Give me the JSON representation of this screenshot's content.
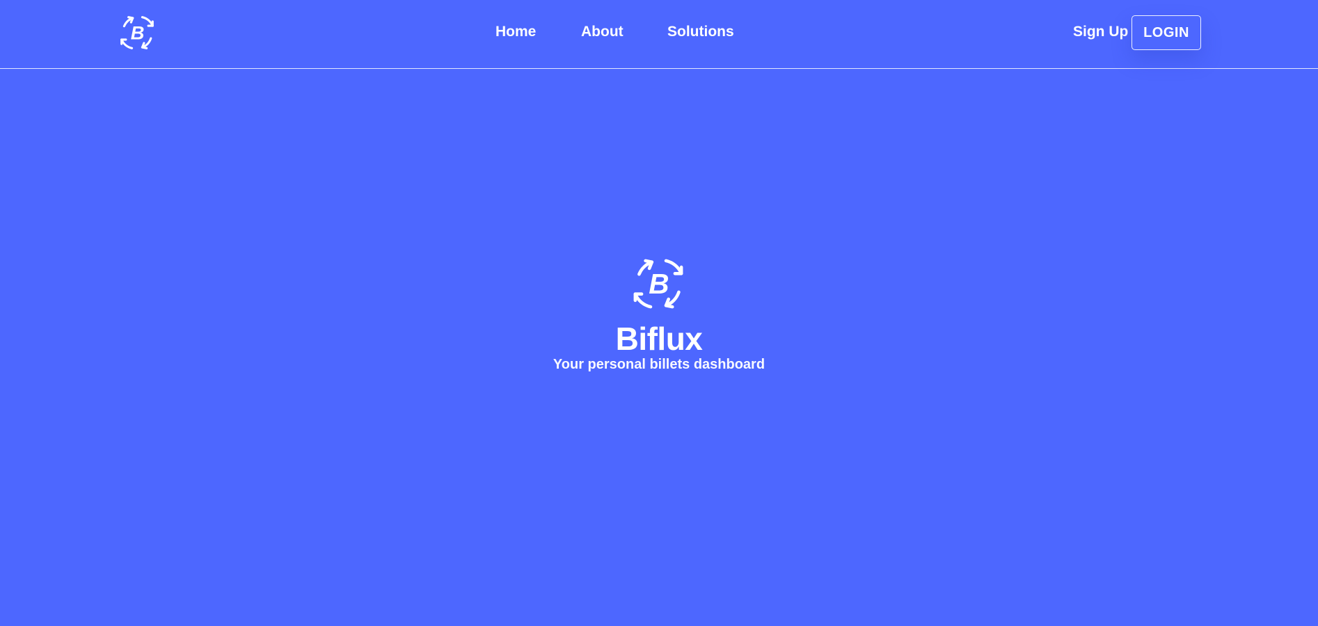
{
  "colors": {
    "background": "#4d67ff",
    "foreground": "#ffffff"
  },
  "navbar": {
    "logo_icon": "biflux-logo-icon",
    "links": [
      {
        "label": "Home"
      },
      {
        "label": "About"
      },
      {
        "label": "Solutions"
      }
    ],
    "signup_label": "Sign Up",
    "login_label": "LOGIN"
  },
  "hero": {
    "logo_icon": "biflux-logo-icon",
    "title": "Biflux",
    "subtitle": "Your personal billets dashboard"
  }
}
